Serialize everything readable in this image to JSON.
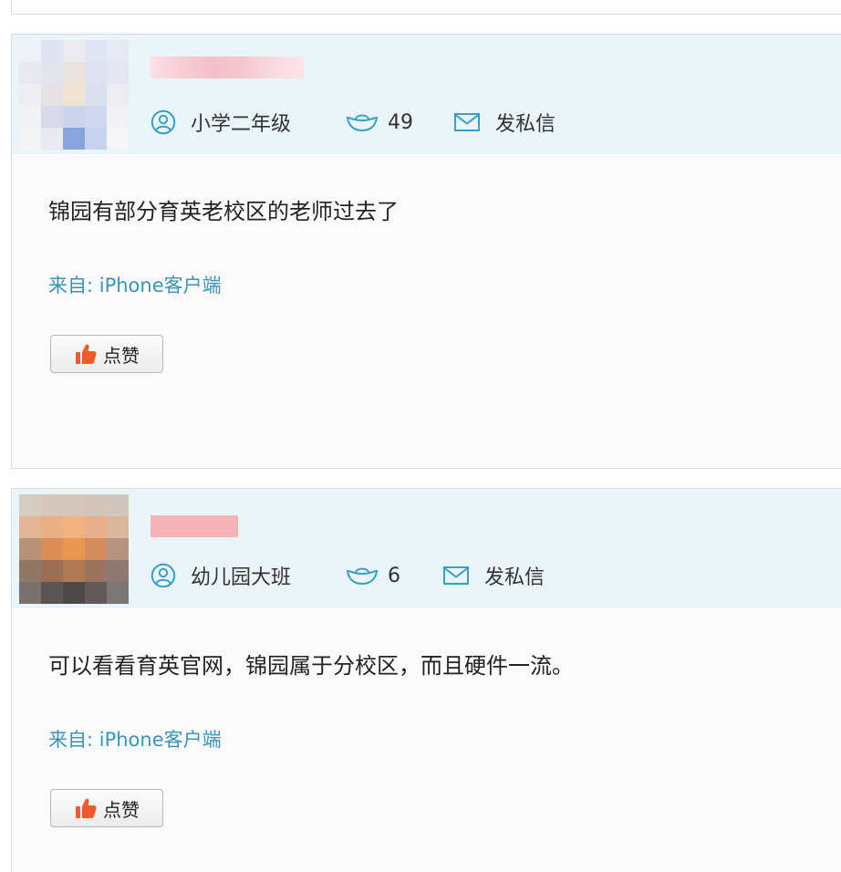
{
  "posts": [
    {
      "grade": "小学二年级",
      "coins": "49",
      "message_label": "发私信",
      "content": "锦园有部分育英老校区的老师过去了",
      "source": "来自: iPhone客户端",
      "like_label": "点赞"
    },
    {
      "grade": "幼儿园大班",
      "coins": "6",
      "message_label": "发私信",
      "content": "可以看看育英官网，锦园属于分校区，而且硬件一流。",
      "source": "来自: iPhone客户端",
      "like_label": "点赞"
    }
  ],
  "icons": {
    "grade": "user-circle-icon",
    "coins": "ingot-icon",
    "message": "envelope-icon",
    "like": "thumbs-up-icon"
  },
  "colors": {
    "header_bg": "#e9f5f8",
    "accent": "#3a9fc4",
    "source_link": "#3a93b8",
    "like_icon": "#f15a2b"
  }
}
